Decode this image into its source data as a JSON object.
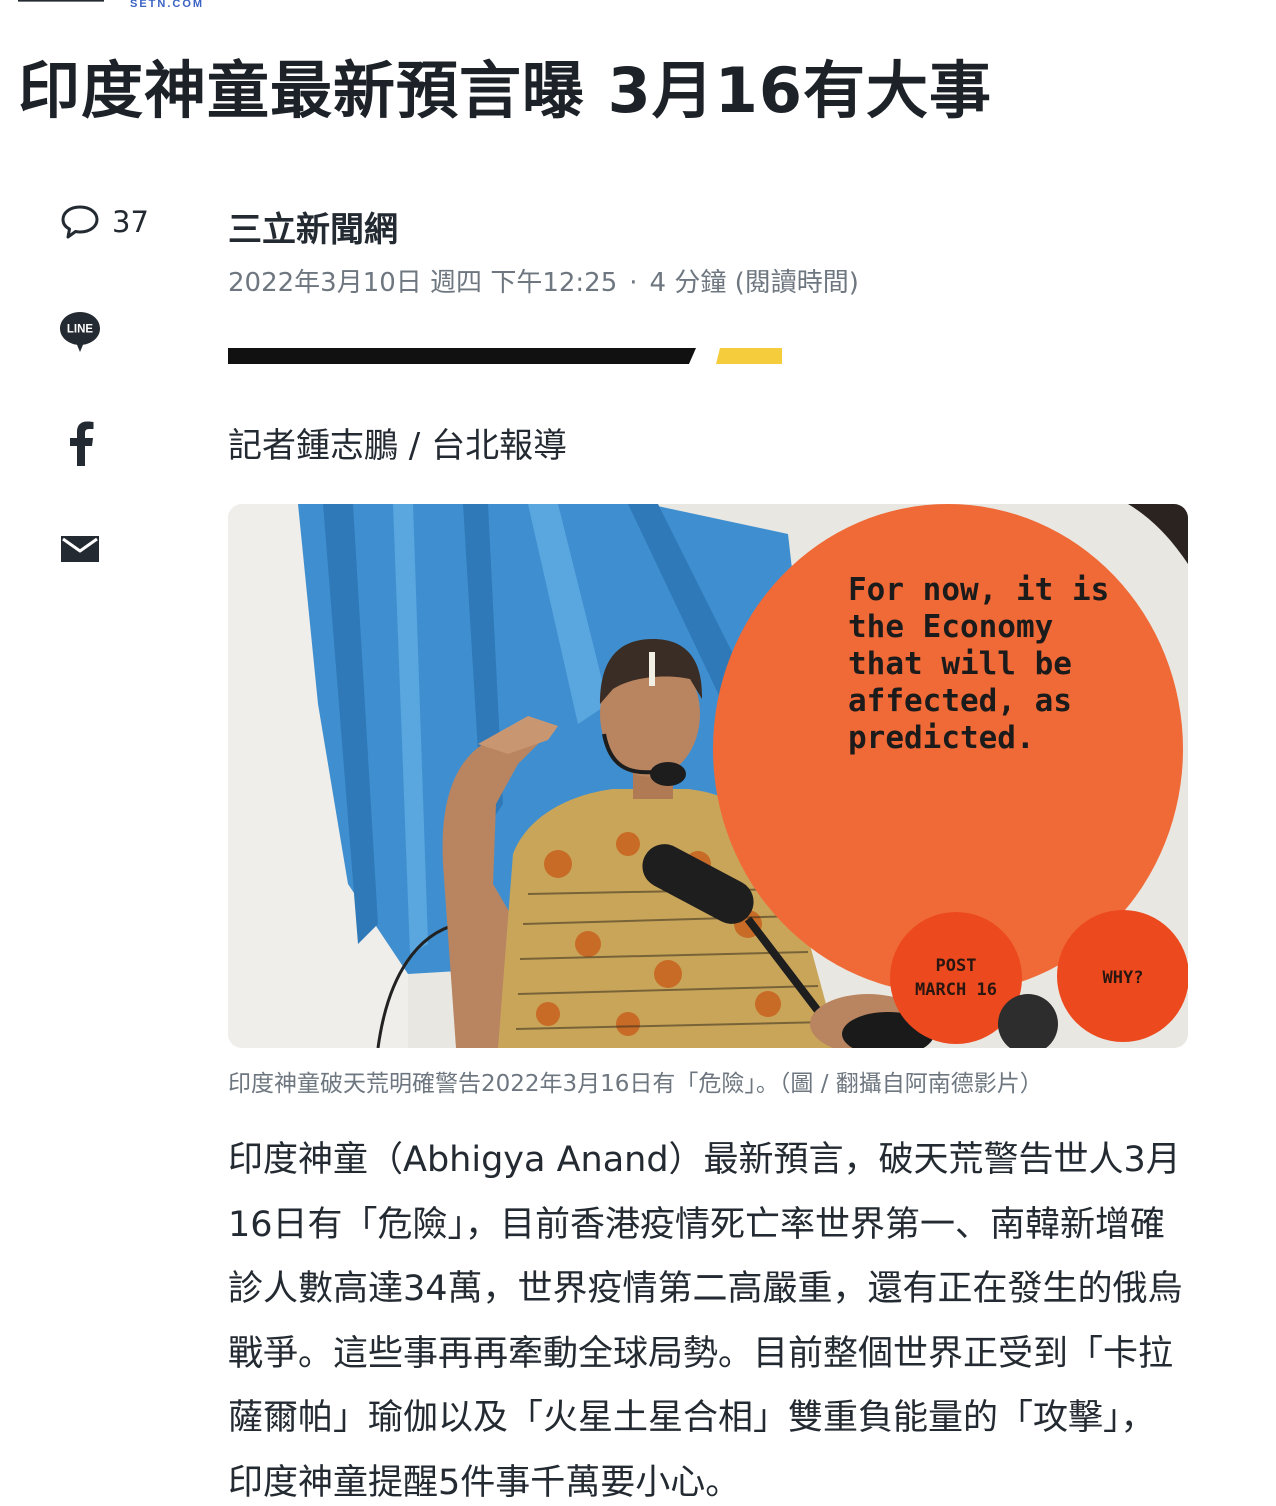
{
  "site": {
    "logo_text": "SETN.COM"
  },
  "article": {
    "headline": "印度神童最新預言曝 3月16有大事",
    "provider": "三立新聞網",
    "date": "2022年3月10日 週四 下午12:25",
    "separator": "·",
    "read_time": "4 分鐘 (閱讀時間)",
    "byline": "記者鍾志鵬 / 台北報導",
    "image": {
      "bubble_text": "For now, it is\nthe Economy\nthat will be\naffected, as\npredicted.",
      "badge_left": "POST\nMARCH 16",
      "badge_right": "WHY?"
    },
    "caption": "印度神童破天荒明確警告2022年3月16日有「危險」。（圖 / 翻攝自阿南德影片）",
    "body_paragraph": "印度神童（Abhigya Anand）最新預言，破天荒警告世人3月16日有「危險」，目前香港疫情死亡率世界第一、南韓新增確診人數高達34萬，世界疫情第二高嚴重，還有正在發生的俄烏戰爭。這些事再再牽動全球局勢。目前整個世界正受到「卡拉薩爾帕」瑜伽以及「火星土星合相」雙重負能量的「攻擊」，印度神童提醒5件事千萬要小心。"
  },
  "share_rail": {
    "comment_icon": "comment-bubble-icon",
    "comment_count": "37",
    "line_icon_label": "LINE",
    "facebook_icon": "facebook-icon",
    "mail_icon": "mail-icon"
  },
  "colors": {
    "text_primary": "#1d2228",
    "text_secondary": "#6e7780",
    "divider_black": "#111111",
    "divider_yellow": "#f5cd3c",
    "bubble_orange": "#f06a37",
    "curtain_blue": "#3c8fd1"
  }
}
